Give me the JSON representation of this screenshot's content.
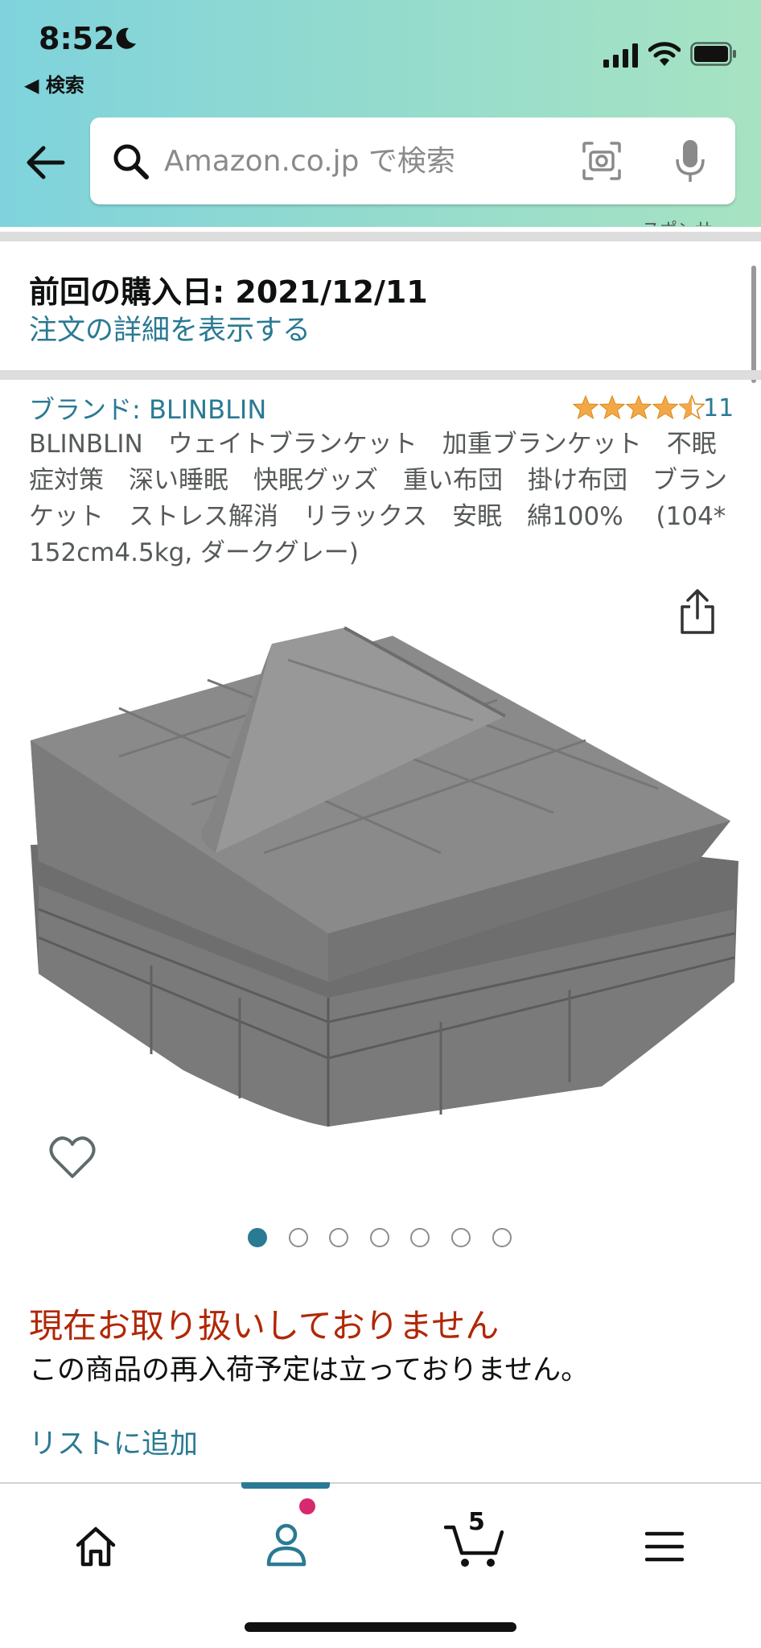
{
  "status_bar": {
    "time": "8:52",
    "back_app": "◀ 検索"
  },
  "search": {
    "placeholder": "Amazon.co.jp で検索"
  },
  "cutoff_text": "スポンサ",
  "purchase": {
    "date_label": "前回の購入日: 2021/12/11",
    "order_link": "注文の詳細を表示する"
  },
  "product": {
    "brand": "ブランド: BLINBLIN",
    "rating": 4.5,
    "rating_count": "11",
    "title": "BLINBLIN　ウェイトブランケット　加重ブランケット　不眠症対策　深い睡眠　快眠グッズ　重い布団　掛け布団　ブランケット　ストレス解消　リラックス　安眠　綿100%　 (104*152cm4.5kg, ダークグレー)",
    "image_count": 7,
    "active_image": 1
  },
  "availability": {
    "status": "現在お取り扱いしておりません",
    "restock": "この商品の再入荷予定は立っておりません。",
    "add_to_list": "リストに追加"
  },
  "nav": {
    "active": "account",
    "cart_count": "5",
    "items": [
      "home-icon",
      "account-icon",
      "cart-icon",
      "menu-icon"
    ]
  },
  "colors": {
    "link": "#2a7a93",
    "unavailable": "#b12704",
    "star": "#f3a847"
  }
}
